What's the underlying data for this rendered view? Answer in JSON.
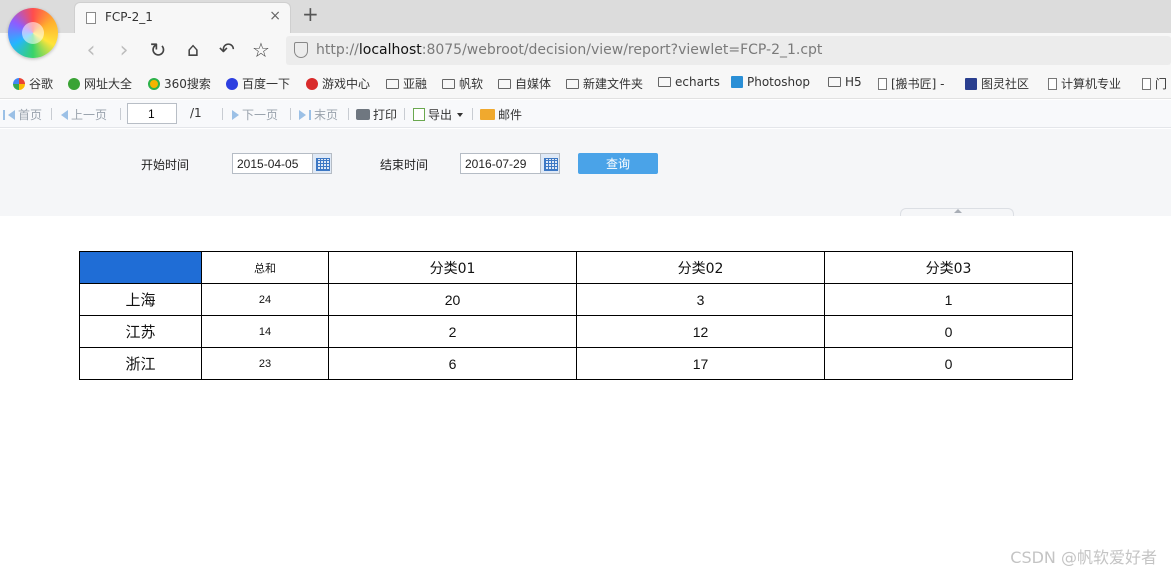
{
  "browser": {
    "tab_title": "FCP-2_1",
    "tab_close": "×",
    "new_tab": "+",
    "url_prefix": "http://",
    "url_host": "localhost",
    "url_rest": ":8075/webroot/decision/view/report?viewlet=FCP-2_1.cpt"
  },
  "bookmarks": [
    {
      "label": "谷歌",
      "icon": "google-icon"
    },
    {
      "label": "网址大全",
      "icon": "site-nav-icon"
    },
    {
      "label": "360搜索",
      "icon": "search-360-icon"
    },
    {
      "label": "百度一下",
      "icon": "baidu-icon"
    },
    {
      "label": "游戏中心",
      "icon": "game-icon"
    },
    {
      "label": "亚融",
      "icon": "folder-icon"
    },
    {
      "label": "帆软",
      "icon": "folder-icon"
    },
    {
      "label": "自媒体",
      "icon": "folder-icon"
    },
    {
      "label": "新建文件夹",
      "icon": "folder-icon"
    },
    {
      "label": "echarts",
      "icon": "folder-icon"
    },
    {
      "label": "Photoshop",
      "icon": "photoshop-icon"
    },
    {
      "label": "H5",
      "icon": "folder-icon"
    },
    {
      "label": "[搬书匠] -",
      "icon": "page-icon"
    },
    {
      "label": "图灵社区",
      "icon": "turing-icon"
    },
    {
      "label": "计算机专业",
      "icon": "page-icon"
    },
    {
      "label": "门",
      "icon": "page-icon"
    }
  ],
  "toolbar": {
    "first_page": "首页",
    "prev_page": "上一页",
    "page_number": "1",
    "page_total": "/1",
    "next_page": "下一页",
    "last_page": "末页",
    "print": "打印",
    "export": "导出",
    "email": "邮件"
  },
  "params": {
    "start_label": "开始时间",
    "start_value": "2015-04-05",
    "end_label": "结束时间",
    "end_value": "2016-07-29",
    "query_label": "查询"
  },
  "report": {
    "header": {
      "total": "总和",
      "cat1": "分类01",
      "cat2": "分类02",
      "cat3": "分类03"
    },
    "rows": [
      {
        "region": "上海",
        "total": "24",
        "cat1": "20",
        "cat2": "3",
        "cat3": "1"
      },
      {
        "region": "江苏",
        "total": "14",
        "cat1": "2",
        "cat2": "12",
        "cat3": "0"
      },
      {
        "region": "浙江",
        "total": "23",
        "cat1": "6",
        "cat2": "17",
        "cat3": "0"
      }
    ],
    "corner_color": "#1f6dd6"
  },
  "watermark": "CSDN @帆软爱好者"
}
